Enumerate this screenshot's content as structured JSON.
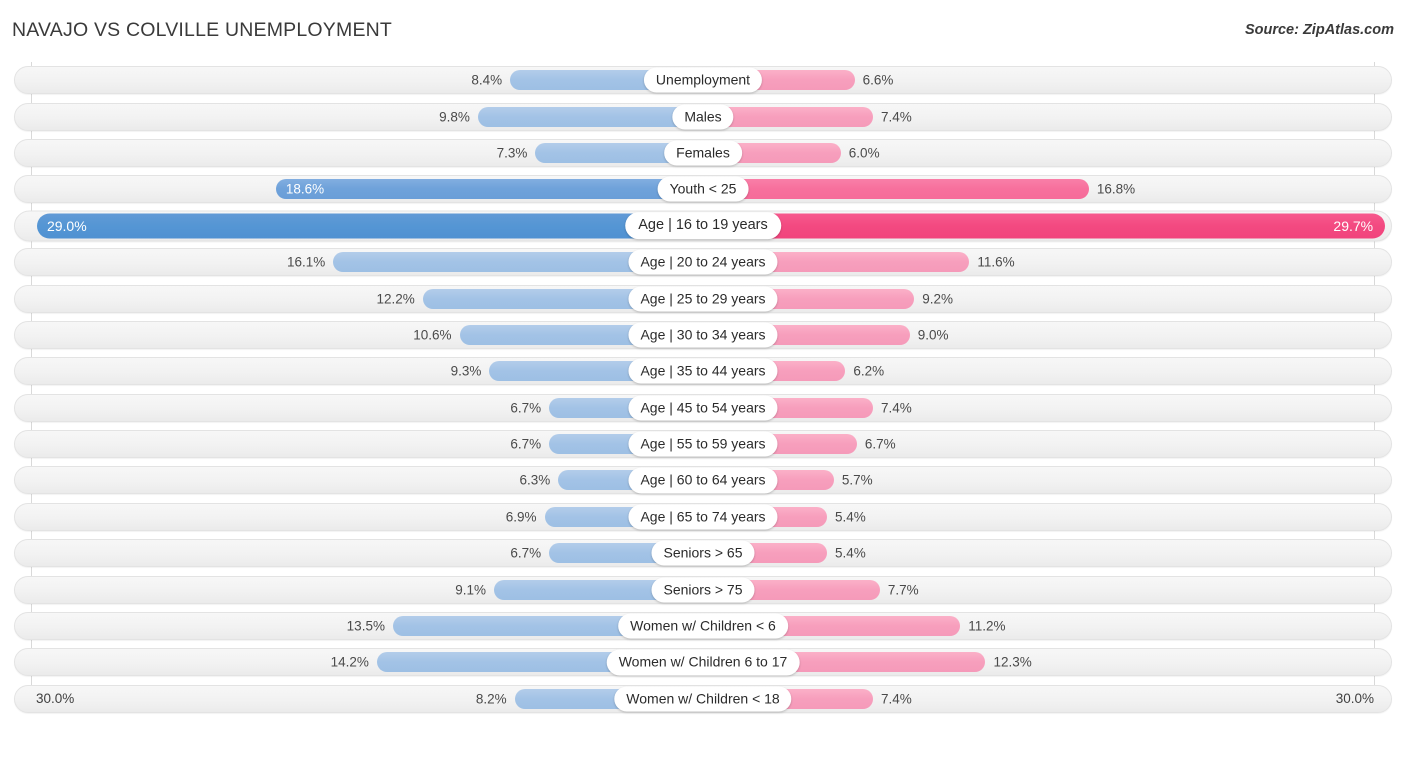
{
  "header": {
    "title": "NAVAJO VS COLVILLE UNEMPLOYMENT",
    "source": "Source: ZipAtlas.com"
  },
  "legend": {
    "items": [
      {
        "label": "Navajo",
        "color": "#5a9bd5"
      },
      {
        "label": "Colville",
        "color": "#f2507f"
      }
    ]
  },
  "axis": {
    "left_label": "30.0%",
    "right_label": "30.0%",
    "max": 30.0
  },
  "chart_data": {
    "type": "bar",
    "title": "NAVAJO VS COLVILLE UNEMPLOYMENT",
    "subtitle": "Source: ZipAtlas.com",
    "orientation": "horizontal-diverging",
    "xlabel": "",
    "ylabel": "",
    "xlim": [
      -30.0,
      30.0
    ],
    "axis_max": 30.0,
    "grid": true,
    "legend_position": "bottom-center",
    "categories": [
      "Unemployment",
      "Males",
      "Females",
      "Youth < 25",
      "Age | 16 to 19 years",
      "Age | 20 to 24 years",
      "Age | 25 to 29 years",
      "Age | 30 to 34 years",
      "Age | 35 to 44 years",
      "Age | 45 to 54 years",
      "Age | 55 to 59 years",
      "Age | 60 to 64 years",
      "Age | 65 to 74 years",
      "Seniors > 65",
      "Seniors > 75",
      "Women w/ Children < 6",
      "Women w/ Children 6 to 17",
      "Women w/ Children < 18"
    ],
    "series": [
      {
        "name": "Navajo",
        "color": "#5a9bd5",
        "side": "left",
        "values": [
          8.4,
          9.8,
          7.3,
          18.6,
          29.0,
          16.1,
          12.2,
          10.6,
          9.3,
          6.7,
          6.7,
          6.3,
          6.9,
          6.7,
          9.1,
          13.5,
          14.2,
          8.2
        ]
      },
      {
        "name": "Colville",
        "color": "#f2507f",
        "side": "right",
        "values": [
          6.6,
          7.4,
          6.0,
          16.8,
          29.7,
          11.6,
          9.2,
          9.0,
          6.2,
          7.4,
          6.7,
          5.7,
          5.4,
          5.4,
          7.7,
          11.2,
          12.3,
          7.4
        ]
      }
    ]
  },
  "rows": [
    {
      "label": "Unemployment",
      "left": "8.4%",
      "right": "6.6%",
      "lv": 8.4,
      "rv": 6.6,
      "tone": "lo",
      "big": false
    },
    {
      "label": "Males",
      "left": "9.8%",
      "right": "7.4%",
      "lv": 9.8,
      "rv": 7.4,
      "tone": "lo",
      "big": false
    },
    {
      "label": "Females",
      "left": "7.3%",
      "right": "6.0%",
      "lv": 7.3,
      "rv": 6.0,
      "tone": "lo",
      "big": false
    },
    {
      "label": "Youth < 25",
      "left": "18.6%",
      "right": "16.8%",
      "lv": 18.6,
      "rv": 16.8,
      "tone": "mid",
      "big": false
    },
    {
      "label": "Age | 16 to 19 years",
      "left": "29.0%",
      "right": "29.7%",
      "lv": 29.0,
      "rv": 29.7,
      "tone": "hi",
      "big": true
    },
    {
      "label": "Age | 20 to 24 years",
      "left": "16.1%",
      "right": "11.6%",
      "lv": 16.1,
      "rv": 11.6,
      "tone": "lo",
      "big": false
    },
    {
      "label": "Age | 25 to 29 years",
      "left": "12.2%",
      "right": "9.2%",
      "lv": 12.2,
      "rv": 9.2,
      "tone": "lo",
      "big": false
    },
    {
      "label": "Age | 30 to 34 years",
      "left": "10.6%",
      "right": "9.0%",
      "lv": 10.6,
      "rv": 9.0,
      "tone": "lo",
      "big": false
    },
    {
      "label": "Age | 35 to 44 years",
      "left": "9.3%",
      "right": "6.2%",
      "lv": 9.3,
      "rv": 6.2,
      "tone": "lo",
      "big": false
    },
    {
      "label": "Age | 45 to 54 years",
      "left": "6.7%",
      "right": "7.4%",
      "lv": 6.7,
      "rv": 7.4,
      "tone": "lo",
      "big": false
    },
    {
      "label": "Age | 55 to 59 years",
      "left": "6.7%",
      "right": "6.7%",
      "lv": 6.7,
      "rv": 6.7,
      "tone": "lo",
      "big": false
    },
    {
      "label": "Age | 60 to 64 years",
      "left": "6.3%",
      "right": "5.7%",
      "lv": 6.3,
      "rv": 5.7,
      "tone": "lo",
      "big": false
    },
    {
      "label": "Age | 65 to 74 years",
      "left": "6.9%",
      "right": "5.4%",
      "lv": 6.9,
      "rv": 5.4,
      "tone": "lo",
      "big": false
    },
    {
      "label": "Seniors > 65",
      "left": "6.7%",
      "right": "5.4%",
      "lv": 6.7,
      "rv": 5.4,
      "tone": "lo",
      "big": false
    },
    {
      "label": "Seniors > 75",
      "left": "9.1%",
      "right": "7.7%",
      "lv": 9.1,
      "rv": 7.7,
      "tone": "lo",
      "big": false
    },
    {
      "label": "Women w/ Children < 6",
      "left": "13.5%",
      "right": "11.2%",
      "lv": 13.5,
      "rv": 11.2,
      "tone": "lo",
      "big": false
    },
    {
      "label": "Women w/ Children 6 to 17",
      "left": "14.2%",
      "right": "12.3%",
      "lv": 14.2,
      "rv": 12.3,
      "tone": "lo",
      "big": false
    },
    {
      "label": "Women w/ Children < 18",
      "left": "8.2%",
      "right": "7.4%",
      "lv": 8.2,
      "rv": 7.4,
      "tone": "lo",
      "big": false
    }
  ]
}
